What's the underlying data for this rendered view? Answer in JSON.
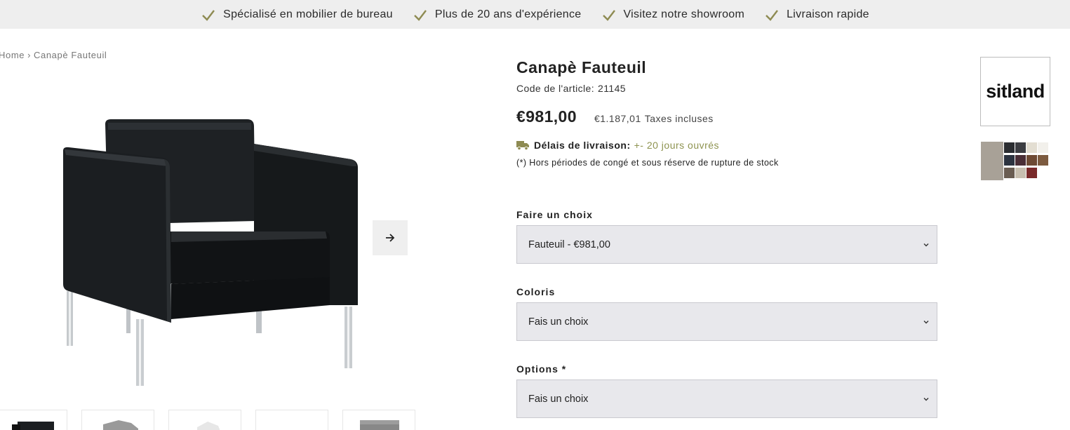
{
  "topbar": {
    "items": [
      "Spécialisé en mobilier de bureau",
      "Plus de 20 ans d'expérience",
      "Visitez notre showroom",
      "Livraison rapide"
    ],
    "check_color": "#8e8b52"
  },
  "breadcrumb": {
    "home": "Home",
    "separator": "›",
    "current": "Canapè Fauteuil"
  },
  "gallery": {
    "main_image_icon": "armchair-image",
    "next_icon": "arrow-right-icon",
    "thumbnail_count": 5
  },
  "product": {
    "title": "Canapè Fauteuil",
    "sku_label": "Code de l'article:",
    "sku_value": "21145",
    "price": "€981,00",
    "price_incl": "€1.187,01",
    "price_incl_label": "Taxes incluses",
    "delivery_label": "Délais de livraison:",
    "delivery_value": "+- 20 jours ouvrés",
    "delivery_color": "#8e9350",
    "note": "(*) Hors périodes de congé et sous réserve de rupture de stock"
  },
  "options": [
    {
      "label": "Faire un choix",
      "value": "Fauteuil - €981,00"
    },
    {
      "label": "Coloris",
      "value": "Fais un choix"
    },
    {
      "label": "Options *",
      "value": "Fais un choix"
    }
  ],
  "brand": {
    "name": "sitland"
  }
}
